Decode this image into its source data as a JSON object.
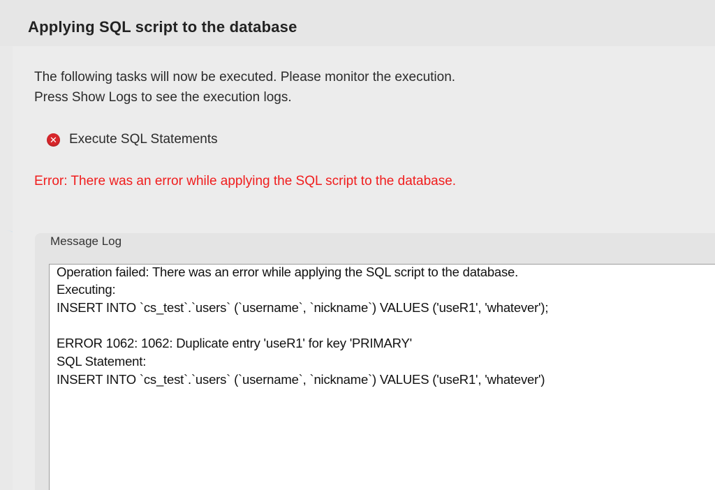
{
  "dialog": {
    "title": "Applying SQL script to the database"
  },
  "intro": {
    "line1": "The following tasks will now be executed. Please monitor the execution.",
    "line2": "Press Show Logs to see the execution logs."
  },
  "tasks": [
    {
      "label": "Execute SQL Statements",
      "status": "error",
      "icon": "error-icon"
    }
  ],
  "error_message": "Error: There was an error while applying the SQL script to the database.",
  "message_log": {
    "label": "Message Log",
    "lines": [
      "Operation failed: There was an error while applying the SQL script to the database.",
      "Executing:",
      "INSERT INTO `cs_test`.`users` (`username`, `nickname`) VALUES ('useR1', 'whatever');",
      "",
      "ERROR 1062: 1062: Duplicate entry 'useR1' for key 'PRIMARY'",
      "SQL Statement:",
      "INSERT INTO `cs_test`.`users` (`username`, `nickname`) VALUES ('useR1', 'whatever')"
    ]
  },
  "colors": {
    "error_text": "#f01d1d",
    "error_icon": "#d7262b",
    "log_background": "#ffffff",
    "window_background": "#ececec"
  }
}
